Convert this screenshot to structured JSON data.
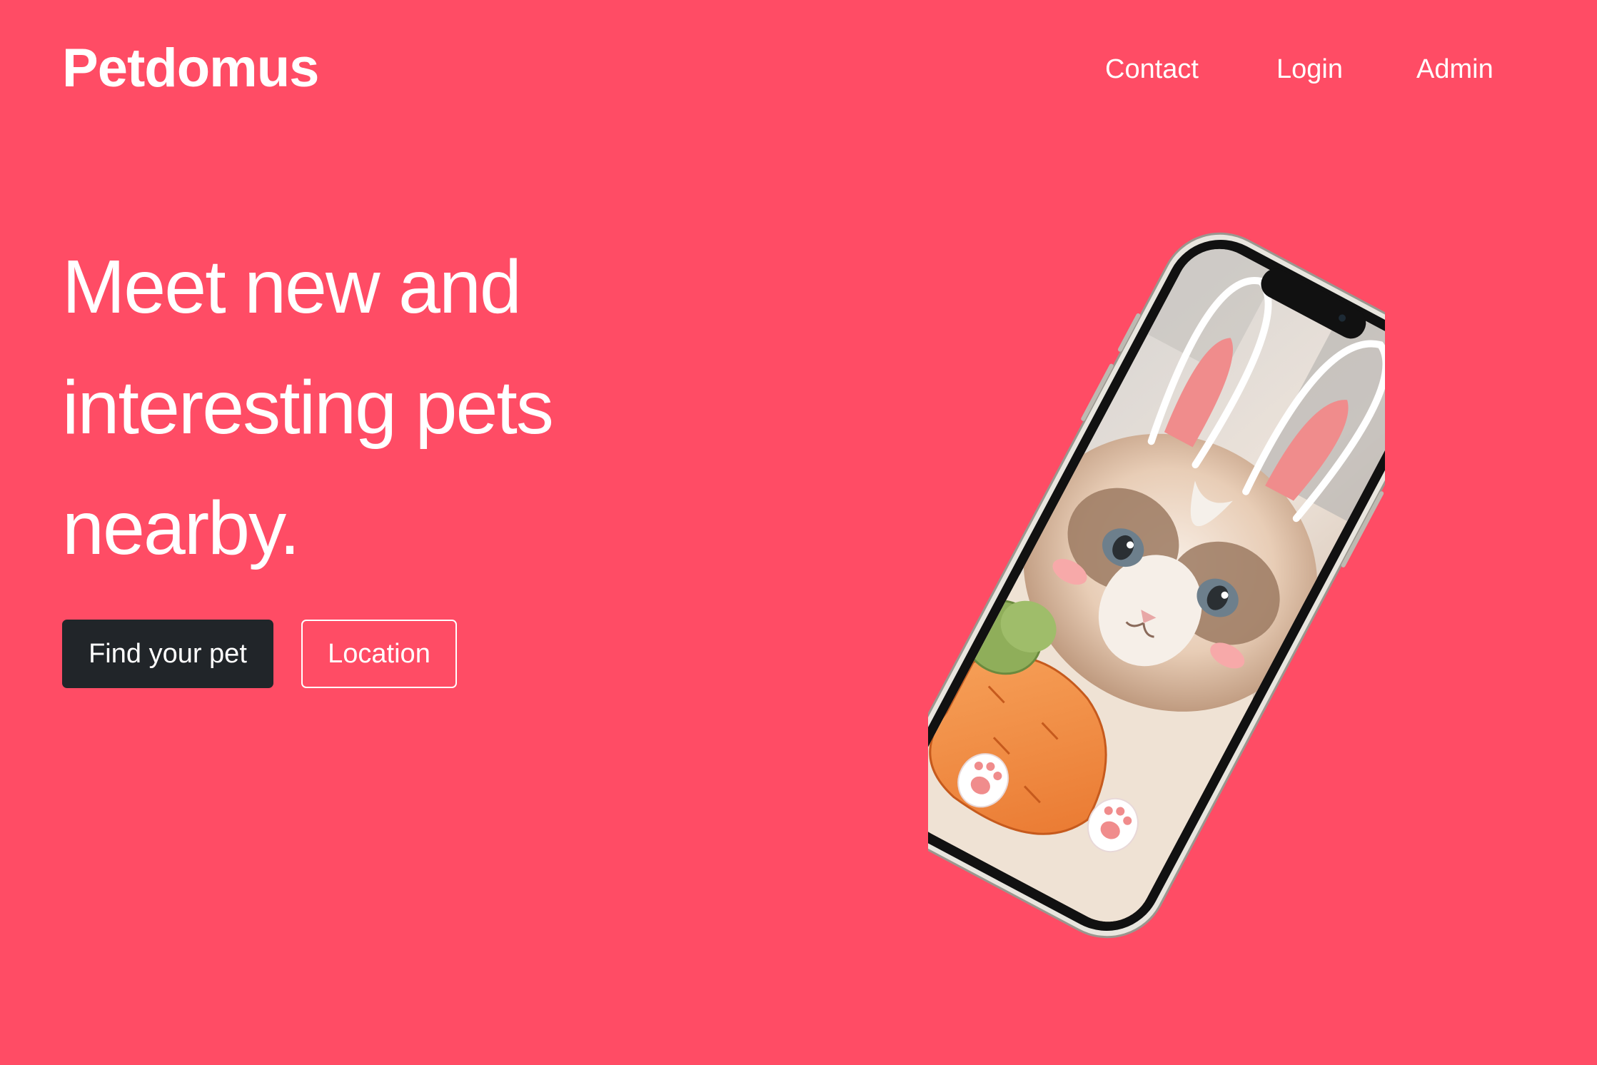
{
  "brand": {
    "name": "Petdomus"
  },
  "nav": {
    "items": [
      {
        "label": "Contact"
      },
      {
        "label": "Login"
      },
      {
        "label": "Admin"
      }
    ]
  },
  "hero": {
    "headline_lines": [
      "Meet new and",
      "interesting pets",
      "nearby."
    ],
    "primary_button": "Find your pet",
    "secondary_button": "Location"
  },
  "colors": {
    "background": "#FF4C65",
    "primary_button": "#212529",
    "text": "#ffffff"
  },
  "icons": {
    "phone_illustration": "phone-with-cat-bunny-ears-image"
  }
}
